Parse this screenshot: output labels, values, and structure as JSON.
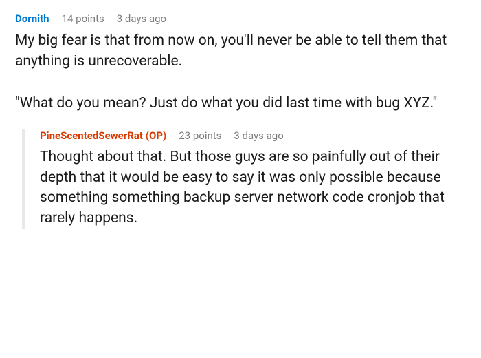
{
  "colors": {
    "author_link": "#0079d3",
    "author_op": "#d93a00",
    "meta_text": "#7c7c7c",
    "body_text": "#1a1a1b",
    "thread_line": "#e8e8e8"
  },
  "comments": [
    {
      "author": "Dornith",
      "is_op": false,
      "points_text": "14 points",
      "age_text": "3 days ago",
      "body": "My big fear is that from now on, you'll never be able to tell them that anything is unrecoverable.\n\n\"What do you mean? Just do what you did last time with bug XYZ.\"",
      "replies": [
        {
          "author": "PineScentedSewerRat",
          "is_op": true,
          "op_label": "(OP)",
          "points_text": "23 points",
          "age_text": "3 days ago",
          "body": "Thought about that. But those guys are so painfully out of their depth that it would be easy to say it was only possible because something something backup server network code cronjob that rarely happens."
        }
      ]
    }
  ]
}
